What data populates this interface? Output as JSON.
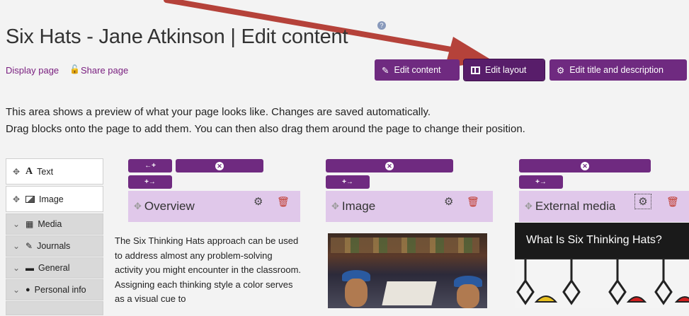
{
  "page": {
    "title": "Six Hats - Jane Atkinson | Edit content",
    "help_icon": "?"
  },
  "links": {
    "display_page": "Display page",
    "share_page": "Share page"
  },
  "toolbar": {
    "edit_content": "Edit content",
    "edit_layout": "Edit layout",
    "edit_title": "Edit title and description"
  },
  "intro": {
    "line1": "This area shows a preview of what your page looks like. Changes are saved automatically.",
    "line2": "Drag blocks onto the page to add them. You can then also drag them around the page to change their position."
  },
  "palette": {
    "items": [
      {
        "label": "Text",
        "icon": "text-icon"
      },
      {
        "label": "Image",
        "icon": "image-icon"
      }
    ],
    "categories": [
      {
        "label": "Media",
        "icon": "film-icon"
      },
      {
        "label": "Journals",
        "icon": "pencil-icon"
      },
      {
        "label": "General",
        "icon": "briefcase-icon"
      },
      {
        "label": "Personal info",
        "icon": "user-icon"
      }
    ]
  },
  "columns": {
    "add_left": "←+",
    "add_right": "+→",
    "remove": "✕"
  },
  "blocks": {
    "overview": {
      "title": "Overview",
      "text": "The Six Thinking Hats approach can be used to address almost any problem-solving activity you might encounter in the classroom. Assigning each thinking style a color serves as a visual cue to"
    },
    "image": {
      "title": "Image"
    },
    "external": {
      "title": "External media",
      "video_title": "What Is Six Thinking Hats?"
    }
  },
  "colors": {
    "primary": "#6f2a80",
    "block_header": "#e0c8ea",
    "arrow": "#b5423a"
  }
}
